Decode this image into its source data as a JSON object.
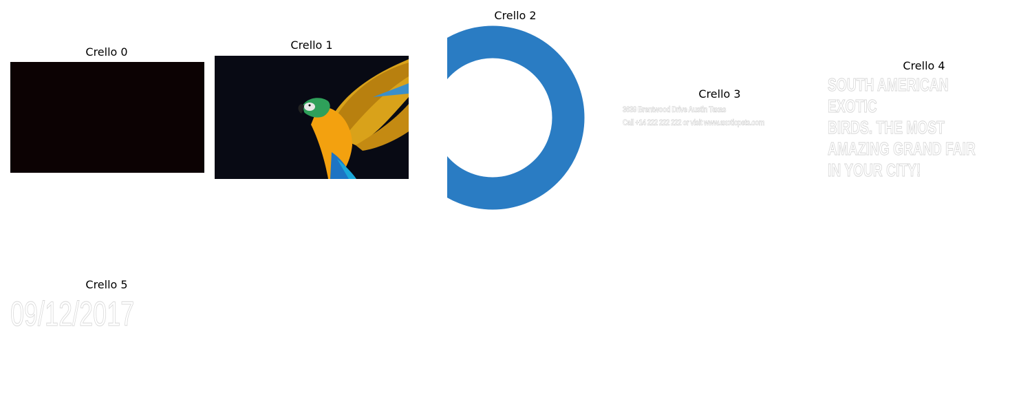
{
  "panels": [
    {
      "title": "Crello 0"
    },
    {
      "title": "Crello 1"
    },
    {
      "title": "Crello 2"
    },
    {
      "title": "Crello 3",
      "lines": [
        "3639 Brentwood Drive Austin Texas",
        "Call +14 222 222 222 or visit www.exoticpets.com"
      ]
    },
    {
      "title": "Crello 4",
      "headline": "SOUTH AMERICAN EXOTIC\nBIRDS. THE MOST\nAMAZING GRAND FAIR\nIN YOUR CITY!"
    },
    {
      "title": "Crello 5",
      "date": "09/12/2017"
    }
  ],
  "colors": {
    "dark_rect": "#0c0203",
    "ring": "#2a7cc3",
    "parrot_bg": "#080a14"
  }
}
